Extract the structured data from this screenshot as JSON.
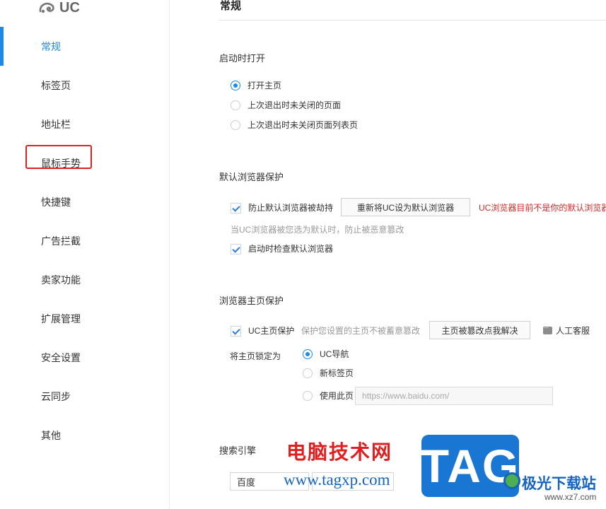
{
  "sidebar": {
    "logo_text": "UC",
    "items": [
      {
        "label": "常规",
        "active": true
      },
      {
        "label": "标签页"
      },
      {
        "label": "地址栏"
      },
      {
        "label": "鼠标手势"
      },
      {
        "label": "快捷键"
      },
      {
        "label": "广告拦截"
      },
      {
        "label": "卖家功能"
      },
      {
        "label": "扩展管理"
      },
      {
        "label": "安全设置"
      },
      {
        "label": "云同步"
      },
      {
        "label": "其他"
      }
    ],
    "highlight_color": "#e02020"
  },
  "main": {
    "title": "常规",
    "startup": {
      "title": "启动时打开",
      "options": [
        "打开主页",
        "上次退出时未关闭的页面",
        "上次退出时未关闭页面列表页"
      ],
      "selected_index": 0
    },
    "default_browser": {
      "title": "默认浏览器保护",
      "prevent_hijack_label": "防止默认浏览器被劫持",
      "prevent_hijack_checked": true,
      "reset_button": "重新将UC设为默认浏览器",
      "warning": "UC浏览器目前不是你的默认浏览器",
      "hint": "当UC浏览器被您选为默认时，防止被恶意篡改",
      "check_on_start_label": "启动时检查默认浏览器",
      "check_on_start_checked": true
    },
    "homepage_protect": {
      "title": "浏览器主页保护",
      "protect_label": "UC主页保护",
      "protect_checked": true,
      "protect_hint": "保护您设置的主页不被蓄意篡改",
      "fix_button": "主页被篡改点我解决",
      "service_label": "人工客服",
      "lock_label": "将主页锁定为",
      "lock_options": [
        "UC导航",
        "新标签页",
        "使用此页"
      ],
      "lock_selected_index": 0,
      "url_placeholder": "https://www.baidu.com/"
    },
    "search": {
      "title": "搜索引擎",
      "engine": "百度"
    }
  },
  "watermark": {
    "site_name": "电脑技术网",
    "site_url": "www.tagxp.com",
    "tag": "TAG",
    "brand": "极光下载站",
    "brand_url": "www.xz7.com"
  },
  "colors": {
    "accent": "#1e88e5",
    "warning": "#d42828"
  }
}
